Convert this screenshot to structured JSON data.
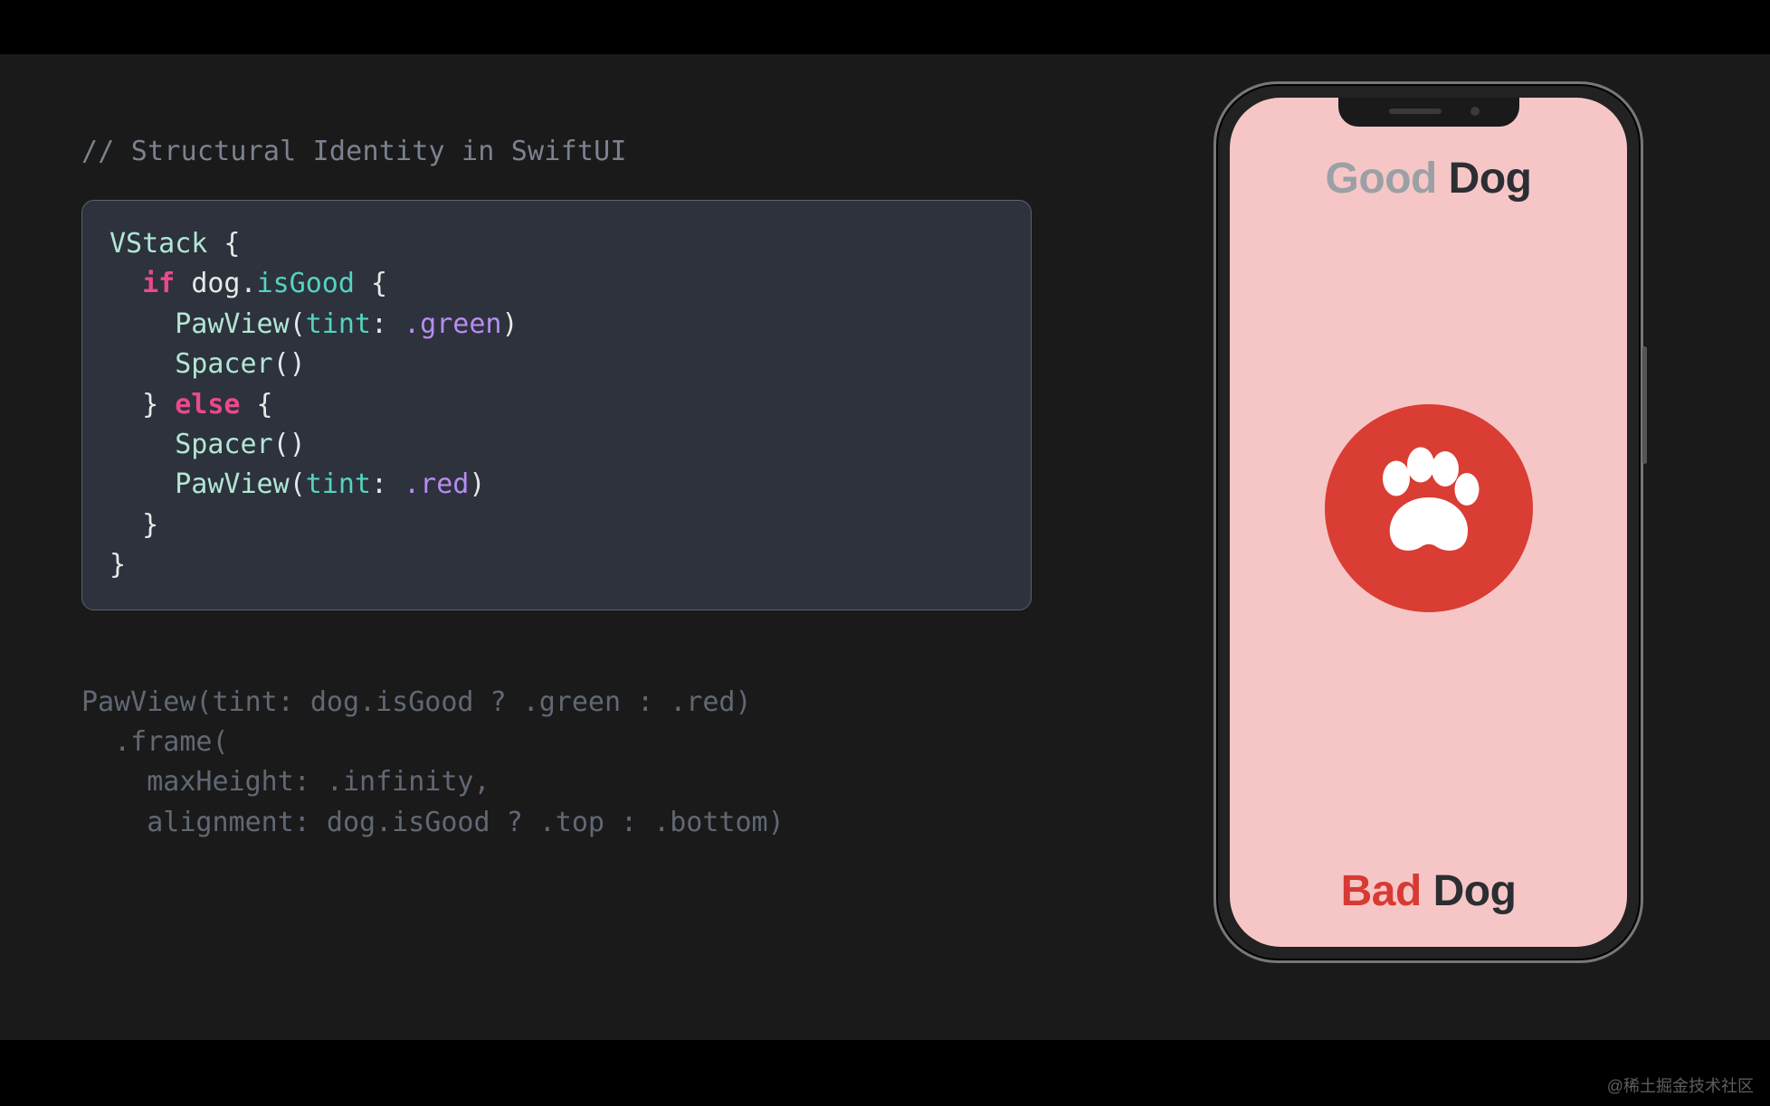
{
  "slide": {
    "comment": "// Structural Identity in SwiftUI",
    "code": {
      "line1_a": "VStack",
      "line1_b": " {",
      "line2_pad": "  ",
      "line2_if": "if",
      "line2_sp": " ",
      "line2_obj": "dog",
      "line2_dot": ".",
      "line2_prop": "isGood",
      "line2_brace": " {",
      "line3_pad": "    ",
      "line3_type": "PawView",
      "line3_open": "(",
      "line3_param": "tint",
      "line3_colon": ": ",
      "line3_enum": ".green",
      "line3_close": ")",
      "line4_pad": "    ",
      "line4_type": "Spacer",
      "line4_call": "()",
      "line5_pad": "  ",
      "line5_text": "} ",
      "line5_else": "else",
      "line5_brace": " {",
      "line6_pad": "    ",
      "line6_type": "Spacer",
      "line6_call": "()",
      "line7_pad": "    ",
      "line7_type": "PawView",
      "line7_open": "(",
      "line7_param": "tint",
      "line7_colon": ": ",
      "line7_enum": ".red",
      "line7_close": ")",
      "line8_pad": "  ",
      "line8_text": "}",
      "line9_text": "}"
    },
    "dimmed": {
      "l1": "PawView(tint: dog.isGood ? .green : .red)",
      "l2": "  .frame(",
      "l3": "    maxHeight: .infinity,",
      "l4": "    alignment: dog.isGood ? .top : .bottom)"
    }
  },
  "phone": {
    "top_word1": "Good",
    "top_word2": " Dog",
    "bottom_word1": "Bad",
    "bottom_word2": " Dog",
    "paw_tint": "#da3d33",
    "screen_bg": "#f6c6c6"
  },
  "watermark": "@稀土掘金技术社区"
}
